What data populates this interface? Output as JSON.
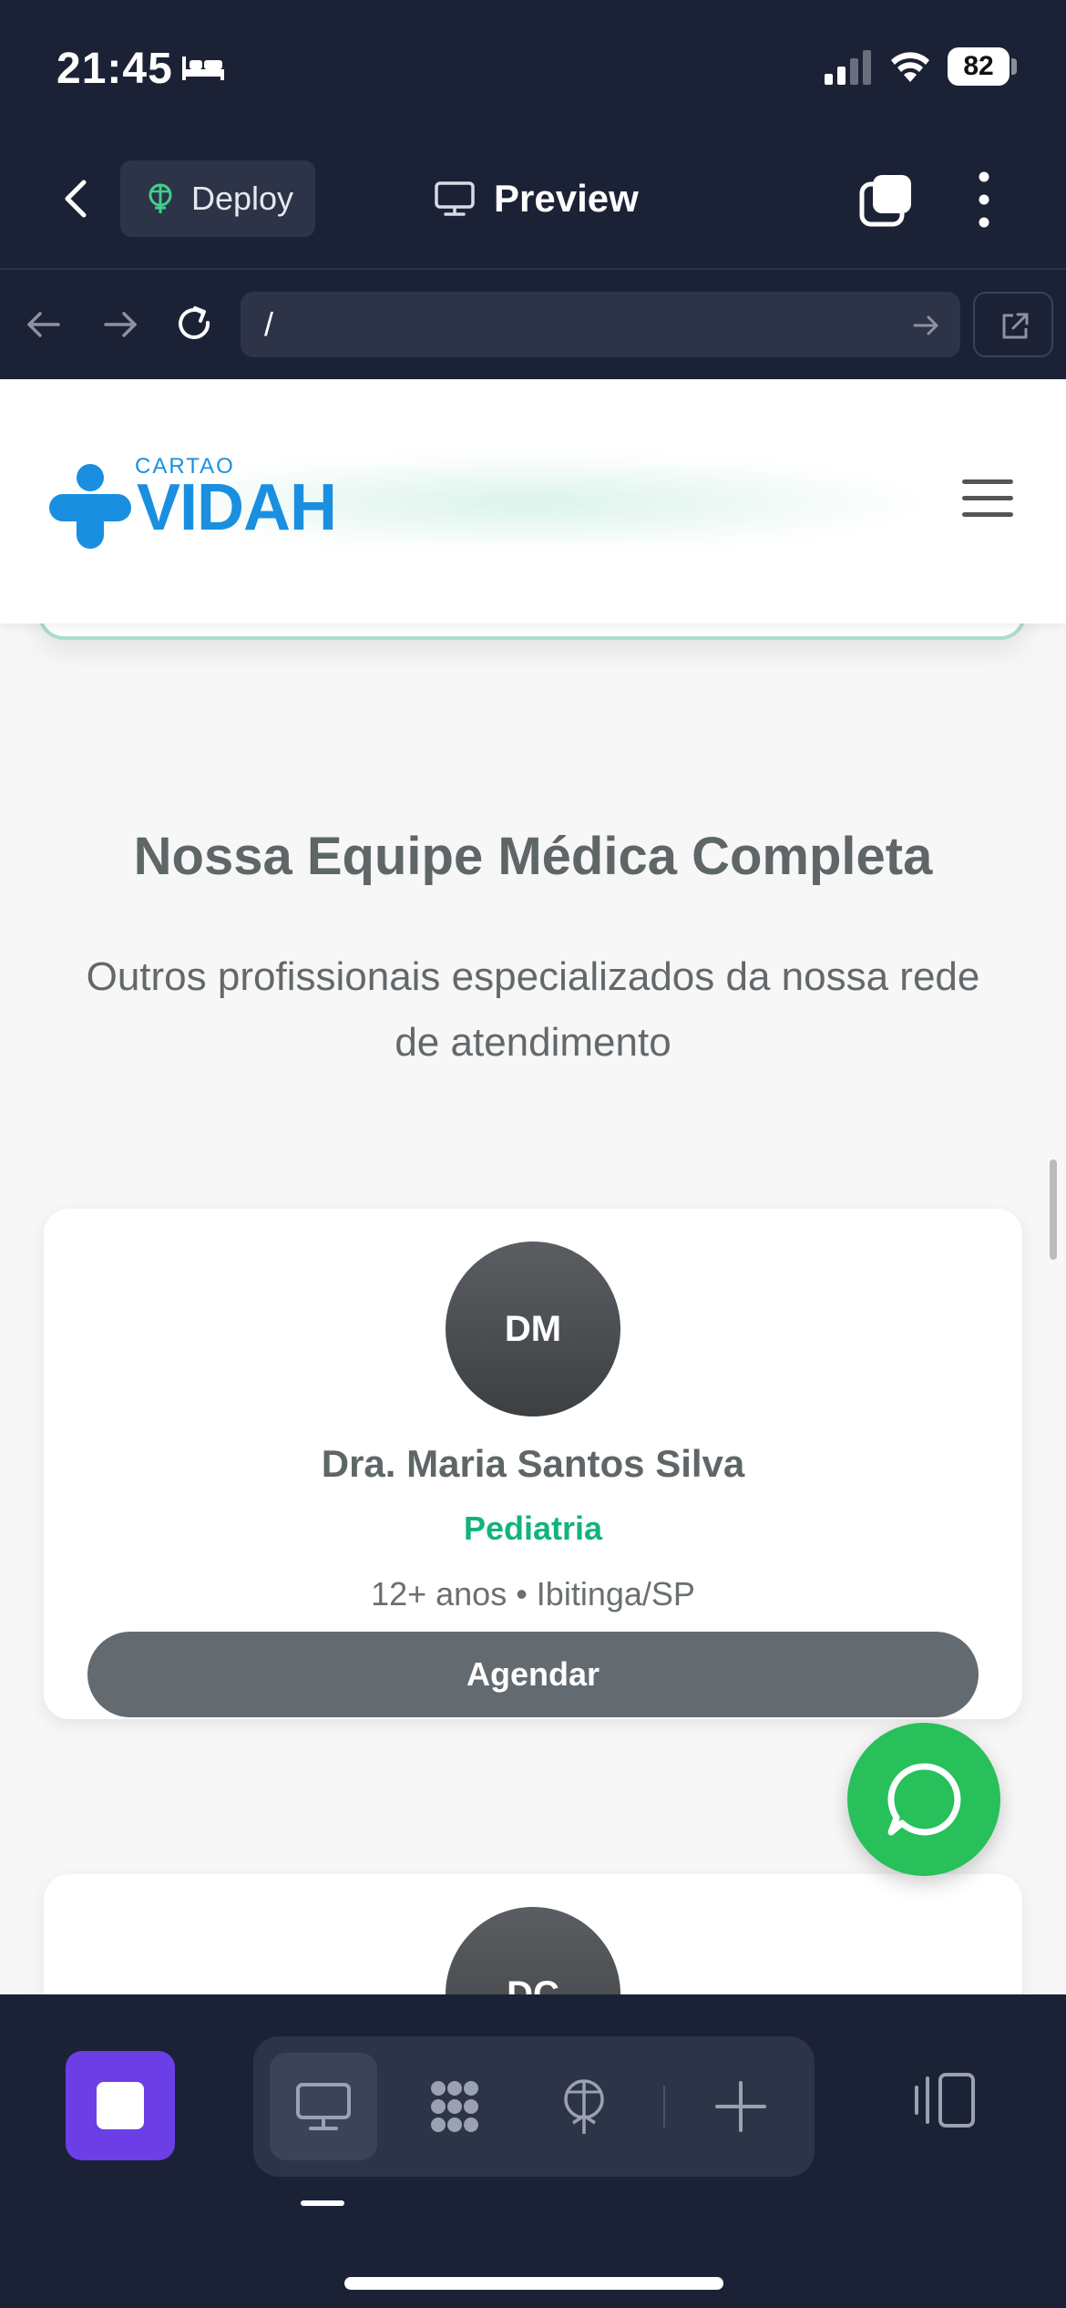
{
  "status_bar": {
    "time": "21:45",
    "battery": "82"
  },
  "toolbar": {
    "deploy_label": "Deploy",
    "preview_label": "Preview"
  },
  "address_bar": {
    "url": "/"
  },
  "site": {
    "logo_small": "CARTAO",
    "logo_big": "VIDAH",
    "section_title": "Nossa Equipe Médica Completa",
    "section_subtitle": "Outros profissionais especializados da nossa rede de atendimento",
    "doctors": [
      {
        "initials": "DM",
        "name": "Dra. Maria Santos Silva",
        "specialty": "Pediatria",
        "meta": "12+ anos • Ibitinga/SP",
        "button": "Agendar"
      },
      {
        "initials": "DC"
      }
    ]
  },
  "colors": {
    "accent_green": "#13b37a",
    "whatsapp_green": "#27c05a",
    "logo_blue": "#1a8fe0",
    "dock_purple": "#6b3ee6"
  },
  "icons": [
    "bed-icon",
    "signal-icon",
    "wifi-icon",
    "back-chevron-icon",
    "deploy-icon",
    "monitor-icon",
    "tabs-icon",
    "more-vertical-icon",
    "arrow-left-icon",
    "arrow-right-icon",
    "reload-icon",
    "external-link-icon",
    "whatsapp-icon",
    "grid-dots-icon",
    "antenna-icon",
    "plus-icon",
    "panel-toggle-icon"
  ]
}
